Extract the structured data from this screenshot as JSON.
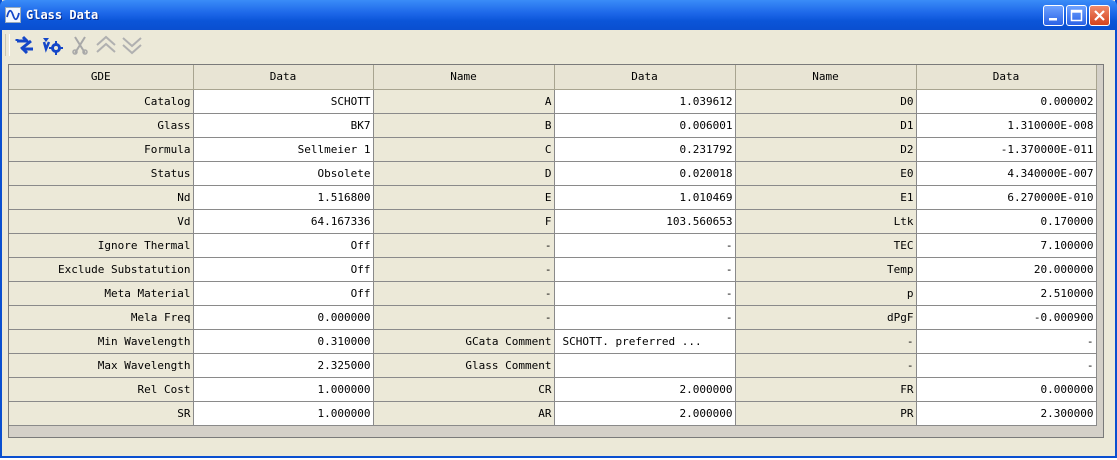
{
  "window": {
    "title": "Glass Data",
    "accent": "#0a4fd0"
  },
  "toolbar": {
    "tools": [
      {
        "name": "refresh-icon",
        "enabled": true
      },
      {
        "name": "settings-icon",
        "enabled": true
      },
      {
        "name": "cut-icon",
        "enabled": false
      },
      {
        "name": "move-up-icon",
        "enabled": false
      },
      {
        "name": "move-down-icon",
        "enabled": false
      }
    ]
  },
  "grid": {
    "headers": [
      "GDE",
      "Data",
      "Name",
      "Data",
      "Name",
      "Data"
    ],
    "rows": [
      [
        "Catalog",
        "SCHOTT",
        "A",
        "1.039612",
        "D0",
        "0.000002"
      ],
      [
        "Glass",
        "BK7",
        "B",
        "0.006001",
        "D1",
        "1.310000E-008"
      ],
      [
        "Formula",
        "Sellmeier 1",
        "C",
        "0.231792",
        "D2",
        "-1.370000E-011"
      ],
      [
        "Status",
        "Obsolete",
        "D",
        "0.020018",
        "E0",
        "4.340000E-007"
      ],
      [
        "Nd",
        "1.516800",
        "E",
        "1.010469",
        "E1",
        "6.270000E-010"
      ],
      [
        "Vd",
        "64.167336",
        "F",
        "103.560653",
        "Ltk",
        "0.170000"
      ],
      [
        "Ignore Thermal",
        "Off",
        "-",
        "-",
        "TEC",
        "7.100000"
      ],
      [
        "Exclude Substatution",
        "Off",
        "-",
        "-",
        "Temp",
        "20.000000"
      ],
      [
        "Meta Material",
        "Off",
        "-",
        "-",
        "p",
        "2.510000"
      ],
      [
        "Mela Freq",
        "0.000000",
        "-",
        "-",
        "dPgF",
        "-0.000900"
      ],
      [
        "Min Wavelength",
        "0.310000",
        "GCata Comment",
        "SCHOTT. preferred ...",
        "-",
        "-"
      ],
      [
        "Max Wavelength",
        "2.325000",
        "Glass Comment",
        "",
        "-",
        "-"
      ],
      [
        "Rel Cost",
        "1.000000",
        "CR",
        "2.000000",
        "FR",
        "0.000000"
      ],
      [
        "SR",
        "1.000000",
        "AR",
        "2.000000",
        "PR",
        "2.300000"
      ]
    ]
  }
}
